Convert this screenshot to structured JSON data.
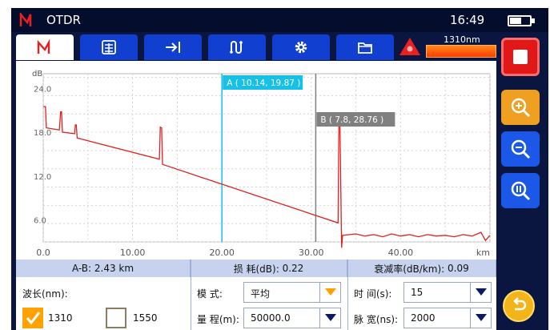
{
  "app": {
    "title": "OTDR",
    "clock": "16:49"
  },
  "status": {
    "wavelength": "1310nm"
  },
  "tabs": [
    {
      "name": "trace",
      "icon": "trace-icon"
    },
    {
      "name": "table",
      "icon": "event-table-icon"
    },
    {
      "name": "export",
      "icon": "arrow-right-bar-icon"
    },
    {
      "name": "link",
      "icon": "link-map-icon"
    },
    {
      "name": "settings",
      "icon": "gear-icon"
    },
    {
      "name": "files",
      "icon": "folder-icon"
    }
  ],
  "chart_data": {
    "type": "line",
    "ylabel": "dB",
    "xunit": "km",
    "xlim": [
      0,
      50
    ],
    "ylim": [
      3,
      26
    ],
    "xticks": [
      "0.0",
      "10.00",
      "20.00",
      "30.00",
      "40.00"
    ],
    "xtick_values": [
      0,
      10,
      20,
      30,
      40
    ],
    "yticks": [
      "6.0",
      "12.0",
      "18.0",
      "24.0"
    ],
    "ytick_values": [
      6,
      12,
      18,
      24
    ],
    "grid": true,
    "series": [
      {
        "points": [
          [
            0,
            21.5
          ],
          [
            0.25,
            21.5
          ],
          [
            0.35,
            18.6
          ],
          [
            1.8,
            18.3
          ],
          [
            1.95,
            20.8
          ],
          [
            2.05,
            20.8
          ],
          [
            2.15,
            18.0
          ],
          [
            3.5,
            17.8
          ],
          [
            3.6,
            19.0
          ],
          [
            3.7,
            19.0
          ],
          [
            3.8,
            17.2
          ],
          [
            13.0,
            14.3
          ],
          [
            13.1,
            18.7
          ],
          [
            13.25,
            18.6
          ],
          [
            13.35,
            13.6
          ],
          [
            33.0,
            5.6
          ],
          [
            33.1,
            20.2
          ],
          [
            33.2,
            20.0
          ],
          [
            33.4,
            2.2
          ],
          [
            33.5,
            3.9
          ],
          [
            35,
            4.1
          ],
          [
            36,
            3.8
          ],
          [
            37,
            4.0
          ],
          [
            38,
            3.7
          ],
          [
            39,
            4.1
          ],
          [
            40,
            3.8
          ],
          [
            41,
            4.0
          ],
          [
            42,
            3.7
          ],
          [
            43,
            4.0
          ],
          [
            44,
            3.8
          ],
          [
            45,
            3.9
          ],
          [
            46,
            3.7
          ],
          [
            47,
            4.0
          ],
          [
            48,
            3.8
          ],
          [
            49,
            4.3
          ],
          [
            49.5,
            3.2
          ],
          [
            50,
            3.9
          ]
        ]
      }
    ],
    "cursors": [
      {
        "id": "A",
        "x": 20.0,
        "label": "A ( 10.14, 19.87 )",
        "color": "#17c0e6"
      },
      {
        "id": "B",
        "x": 30.5,
        "label": "B ( 7.8, 28.76 )",
        "color": "#808080"
      }
    ]
  },
  "info": {
    "ab_distance": "A-B: 2.43 km",
    "loss_label": "损 耗(dB): ",
    "loss_value": "0.22",
    "atten_label": "衰减率(dB/km): ",
    "atten_value": "0.09",
    "wavelength_label": "波长(nm):",
    "wl1": "1310",
    "wl2": "1550",
    "mode_label": "模 式:",
    "mode_value": "平均",
    "range_label": "量 程(m):",
    "range_value": "50000.0",
    "time_label": "时 间(s):",
    "time_value": "15",
    "pulse_label": "脉 宽(ns):",
    "pulse_value": "2000"
  },
  "colors": {
    "accent": "#1140d0",
    "trace": "#e02020",
    "orange": "#ffa200"
  }
}
